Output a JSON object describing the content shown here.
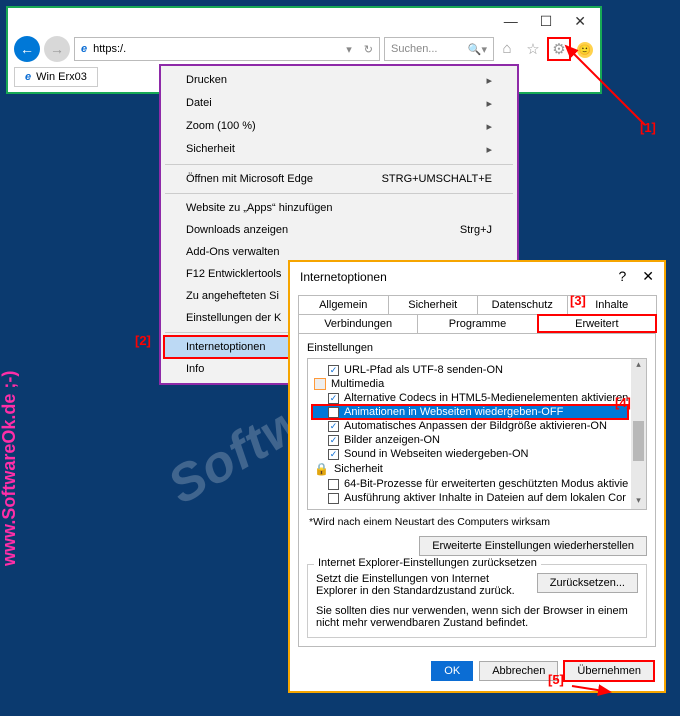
{
  "browser": {
    "url": "https:/.",
    "search_placeholder": "Suchen...",
    "tab_title": "Win Erx03"
  },
  "menu": {
    "print": "Drucken",
    "file": "Datei",
    "zoom": "Zoom (100 %)",
    "security": "Sicherheit",
    "edge": "Öffnen mit Microsoft Edge",
    "edge_sc": "STRG+UMSCHALT+E",
    "apps": "Website zu „Apps“ hinzufügen",
    "downloads": "Downloads anzeigen",
    "downloads_sc": "Strg+J",
    "addons": "Add-Ons verwalten",
    "f12": "F12 Entwicklertools",
    "pinned": "Zu angehefteten Si",
    "compat": "Einstellungen der K",
    "inetopt": "Internetoptionen",
    "info": "Info"
  },
  "dialog": {
    "title": "Internetoptionen",
    "tabs": {
      "general": "Allgemein",
      "security": "Sicherheit",
      "privacy": "Datenschutz",
      "content": "Inhalte",
      "connections": "Verbindungen",
      "programs": "Programme",
      "advanced": "Erweitert"
    },
    "settings_label": "Einstellungen",
    "tree": {
      "url_utf8": "URL-Pfad als UTF-8 senden-ON",
      "multimedia": "Multimedia",
      "codecs": "Alternative Codecs in HTML5-Medienelementen aktivieren-",
      "anim": "Animationen in Webseiten wiedergeben-OFF",
      "autosize": "Automatisches Anpassen der Bildgröße aktivieren-ON",
      "images": "Bilder anzeigen-ON",
      "sound": "Sound in Webseiten wiedergeben-ON",
      "sec_cat": "Sicherheit",
      "bit64": "64-Bit-Prozesse für erweiterten geschützten Modus aktivie",
      "exec": "Ausführung aktiver Inhalte in Dateien auf dem lokalen Cor"
    },
    "restart_note": "*Wird nach einem Neustart des Computers wirksam",
    "restore_btn": "Erweiterte Einstellungen wiederherstellen",
    "reset_group": "Internet Explorer-Einstellungen zurücksetzen",
    "reset_desc": "Setzt die Einstellungen von Internet Explorer in den Standardzustand zurück.",
    "reset_btn": "Zurücksetzen...",
    "reset_warn": "Sie sollten dies nur verwenden, wenn sich der Browser in einem nicht mehr verwendbaren Zustand befindet.",
    "ok": "OK",
    "cancel": "Abbrechen",
    "apply": "Übernehmen"
  },
  "annotations": {
    "a1": "[1]",
    "a2": "[2]",
    "a3": "[3]",
    "a4": "[4]",
    "a5": "[5]"
  },
  "watermark": "SoftwareOK.de",
  "watermark_side": "www.SoftwareOk.de ;-)"
}
